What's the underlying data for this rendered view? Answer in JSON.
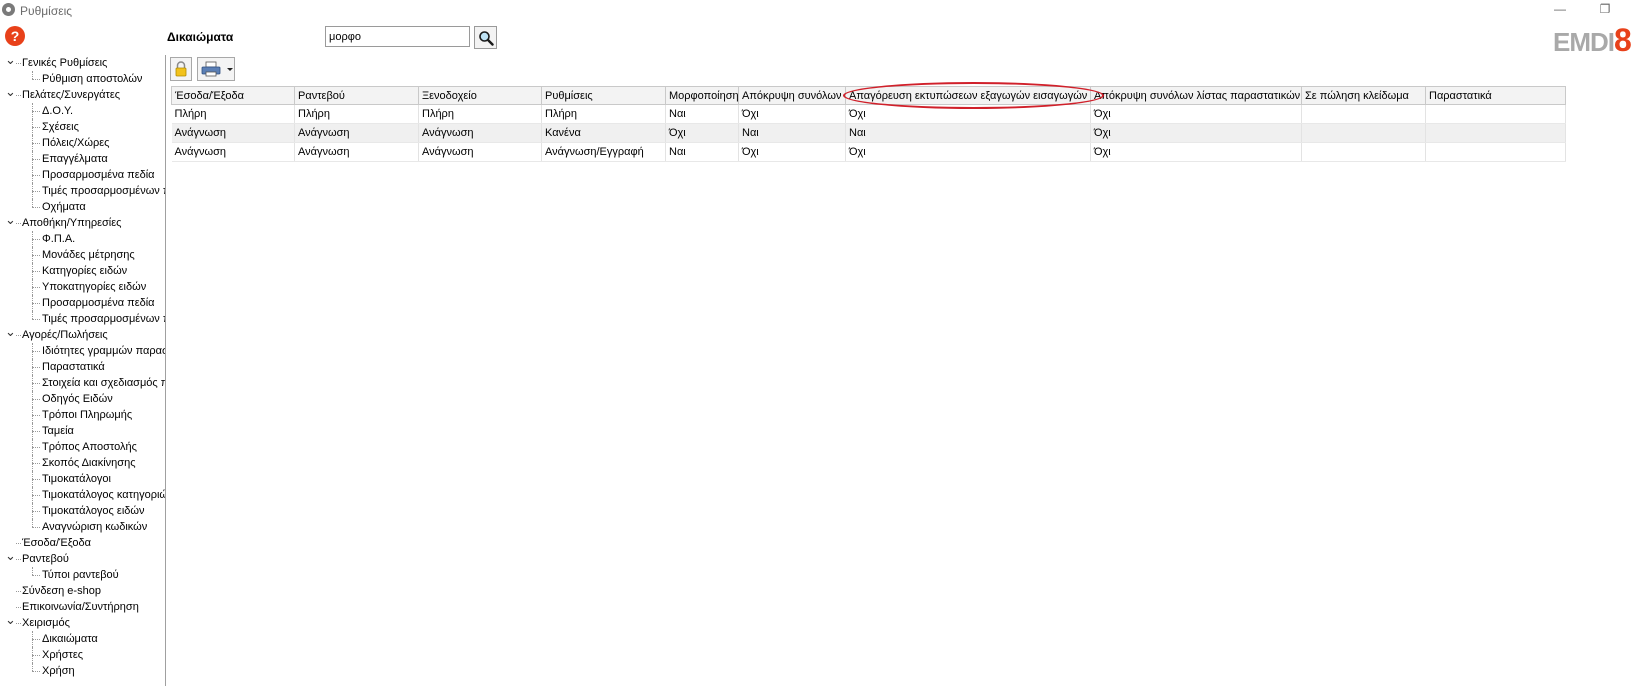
{
  "window": {
    "title": "Ρυθμίσεις",
    "minimize": "—",
    "restore": "❐"
  },
  "help_label": "?",
  "section_title": "Δικαιώματα",
  "search": {
    "value": "μορφο"
  },
  "logo": {
    "part1": "EMDI",
    "part2": "8"
  },
  "tree": [
    {
      "label": "Γενικές Ρυθμίσεις",
      "level": 0,
      "expanded": true
    },
    {
      "label": "Ρύθμιση αποστολών",
      "level": 1
    },
    {
      "label": "Πελάτες/Συνεργάτες",
      "level": 0,
      "expanded": true
    },
    {
      "label": "Δ.Ο.Υ.",
      "level": 1
    },
    {
      "label": "Σχέσεις",
      "level": 1
    },
    {
      "label": "Πόλεις/Χώρες",
      "level": 1
    },
    {
      "label": "Επαγγέλματα",
      "level": 1
    },
    {
      "label": "Προσαρμοσμένα πεδία",
      "level": 1
    },
    {
      "label": "Τιμές προσαρμοσμένων π",
      "level": 1
    },
    {
      "label": "Οχήματα",
      "level": 1
    },
    {
      "label": "Αποθήκη/Υπηρεσίες",
      "level": 0,
      "expanded": true
    },
    {
      "label": "Φ.Π.Α.",
      "level": 1
    },
    {
      "label": "Μονάδες μέτρησης",
      "level": 1
    },
    {
      "label": "Κατηγορίες ειδών",
      "level": 1
    },
    {
      "label": "Υποκατηγορίες ειδών",
      "level": 1
    },
    {
      "label": "Προσαρμοσμένα πεδία",
      "level": 1
    },
    {
      "label": "Τιμές προσαρμοσμένων π",
      "level": 1
    },
    {
      "label": "Αγορές/Πωλήσεις",
      "level": 0,
      "expanded": true
    },
    {
      "label": "Ιδιότητες γραμμών παρασ",
      "level": 1
    },
    {
      "label": "Παραστατικά",
      "level": 1
    },
    {
      "label": "Στοιχεία και σχεδιασμός π",
      "level": 1
    },
    {
      "label": "Οδηγός Ειδών",
      "level": 1
    },
    {
      "label": "Τρόποι Πληρωμής",
      "level": 1
    },
    {
      "label": "Ταμεία",
      "level": 1
    },
    {
      "label": "Τρόπος Αποστολής",
      "level": 1
    },
    {
      "label": "Σκοπός Διακίνησης",
      "level": 1
    },
    {
      "label": "Τιμοκατάλογοι",
      "level": 1
    },
    {
      "label": "Τιμοκατάλογος κατηγοριώ",
      "level": 1
    },
    {
      "label": "Τιμοκατάλογος ειδών",
      "level": 1
    },
    {
      "label": "Αναγνώριση κωδικών",
      "level": 1
    },
    {
      "label": "Έσοδα/Έξοδα",
      "level": 0
    },
    {
      "label": "Ραντεβού",
      "level": 0,
      "expanded": true
    },
    {
      "label": "Τύποι ραντεβού",
      "level": 1
    },
    {
      "label": "Σύνδεση e-shop",
      "level": 0
    },
    {
      "label": "Επικοινωνία/Συντήρηση",
      "level": 0
    },
    {
      "label": "Χειρισμός",
      "level": 0,
      "expanded": true
    },
    {
      "label": "Δικαιώματα",
      "level": 1
    },
    {
      "label": "Χρήστες",
      "level": 1
    },
    {
      "label": "Χρήση",
      "level": 1
    }
  ],
  "grid": {
    "columns": [
      "Έσοδα/Έξοδα",
      "Ραντεβού",
      "Ξενοδοχείο",
      "Ρυθμίσεις",
      "Μορφοποίηση",
      "Απόκρυψη συνόλων",
      "Απαγόρευση εκτυπώσεων εξαγωγών εισαγωγών",
      "Απόκρυψη συνόλων λίστας παραστατικών",
      "Σε πώληση κλείδωμα",
      "Παραστατικά"
    ],
    "rows": [
      [
        "Πλήρη",
        "Πλήρη",
        "Πλήρη",
        "Πλήρη",
        "Ναι",
        "Όχι",
        "Όχι",
        "Όχι",
        "",
        ""
      ],
      [
        "Ανάγνωση",
        "Ανάγνωση",
        "Ανάγνωση",
        "Κανένα",
        "Όχι",
        "Ναι",
        "Ναι",
        "Όχι",
        "",
        ""
      ],
      [
        "Ανάγνωση",
        "Ανάγνωση",
        "Ανάγνωση",
        "Ανάγνωση/Εγγραφή",
        "Ναι",
        "Όχι",
        "Όχι",
        "Όχι",
        "",
        ""
      ]
    ]
  },
  "colors": {
    "accent": "#e8411a",
    "annotation": "#d0202a"
  }
}
